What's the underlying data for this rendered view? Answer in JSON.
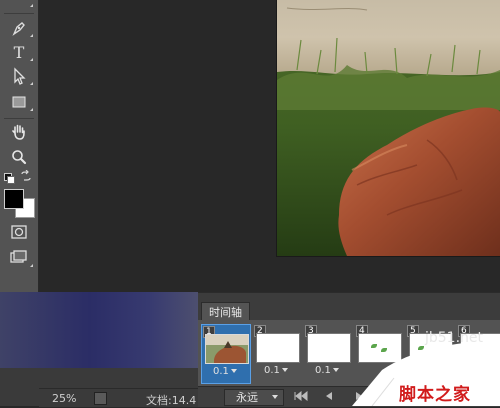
{
  "tools": [
    {
      "name": "pen-tool-icon"
    },
    {
      "name": "type-tool-icon",
      "glyph": "T"
    },
    {
      "name": "path-selection-tool-icon"
    },
    {
      "name": "rectangle-tool-icon"
    },
    {
      "name": "hand-tool-icon"
    },
    {
      "name": "zoom-tool-icon"
    }
  ],
  "colors": {
    "foreground": "#000000",
    "background": "#ffffff",
    "timeline_selected": "#2f6fae",
    "watermark_red": "#d11b1b"
  },
  "timeline": {
    "tab_label": "时间轴",
    "loop_label": "永远",
    "frames": [
      {
        "number": "1",
        "delay": "0.1",
        "selected": true
      },
      {
        "number": "2",
        "delay": "0.1"
      },
      {
        "number": "3",
        "delay": "0.1"
      },
      {
        "number": "4",
        "delay": ""
      },
      {
        "number": "5",
        "delay": ""
      },
      {
        "number": "6",
        "delay": ""
      }
    ]
  },
  "status": {
    "zoom": "25%",
    "doc_info": "文档:14.4"
  },
  "watermark": {
    "url": "jb51.net",
    "site_name": "脚本之家"
  }
}
